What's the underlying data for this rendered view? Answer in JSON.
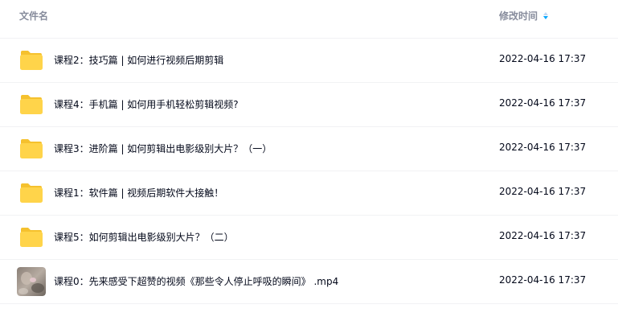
{
  "header": {
    "name_label": "文件名",
    "time_label": "修改时间"
  },
  "rows": [
    {
      "name": "课程2：技巧篇 | 如何进行视频后期剪辑",
      "time": "2022-04-16 17:37",
      "icon": "folder-icon"
    },
    {
      "name": "课程4：手机篇 | 如何用手机轻松剪辑视频?",
      "time": "2022-04-16 17:37",
      "icon": "folder-icon"
    },
    {
      "name": "课程3：进阶篇 | 如何剪辑出电影级别大片？（一）",
      "time": "2022-04-16 17:37",
      "icon": "folder-icon"
    },
    {
      "name": "课程1：软件篇 | 视频后期软件大接触！",
      "time": "2022-04-16 17:37",
      "icon": "folder-icon"
    },
    {
      "name": "课程5：如何剪辑出电影级别大片？（二）",
      "time": "2022-04-16 17:37",
      "icon": "folder-icon"
    },
    {
      "name": "课程0：先来感受下超赞的视频《那些令人停止呼吸的瞬间》 .mp4",
      "time": "2022-04-16 17:37",
      "icon": "video-thumbnail"
    }
  ],
  "colors": {
    "folder": "#ffd44a",
    "folder_tab": "#f5c12e",
    "sort_active": "#06a7ff",
    "header_text": "#878c9c",
    "row_text": "#03081a"
  }
}
